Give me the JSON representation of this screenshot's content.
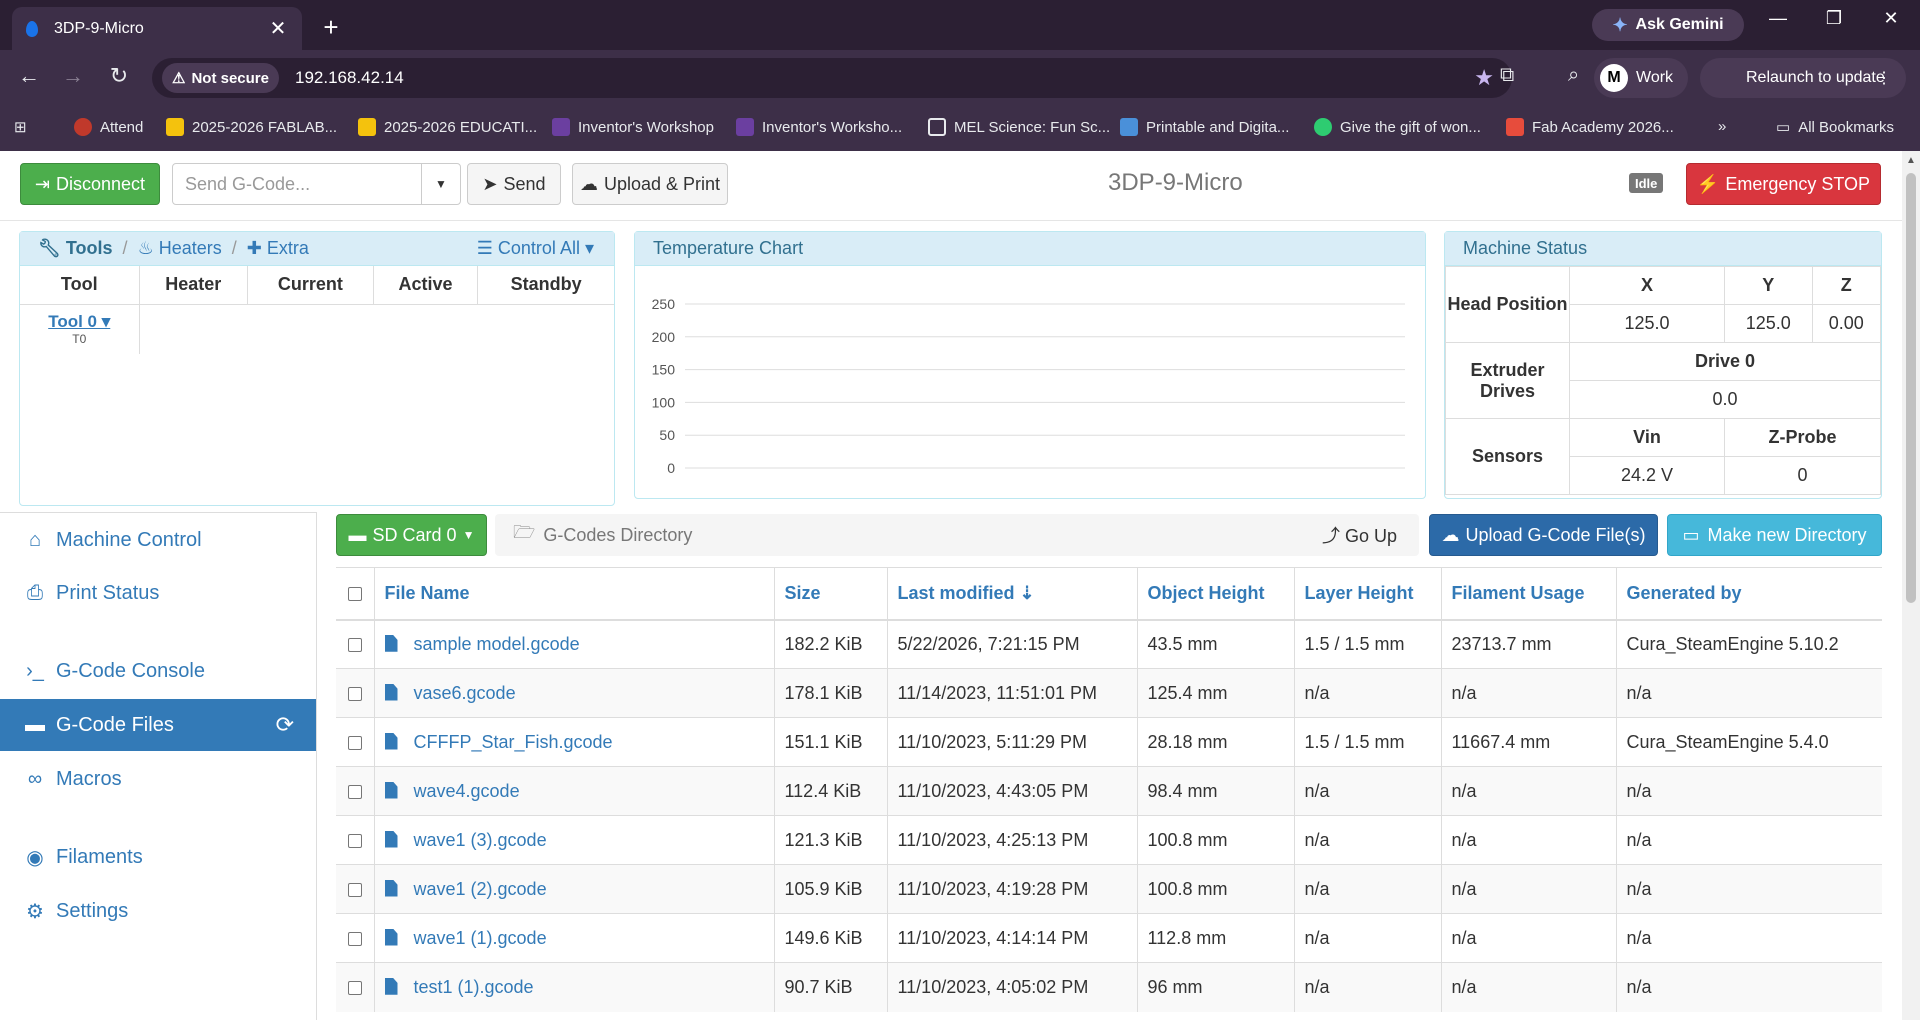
{
  "browser": {
    "tab_title": "3DP-9-Micro",
    "ask_gemini": "Ask Gemini",
    "not_secure": "Not secure",
    "url": "192.168.42.14",
    "profile": "Work",
    "relaunch": "Relaunch to update",
    "bookmarks": [
      "Attend",
      "2025-2026 FABLAB...",
      "2025-2026 EDUCATI...",
      "Inventor's Workshop",
      "Inventor's Worksho...",
      "MEL Science: Fun Sc...",
      "Printable and Digita...",
      "Give the gift of won...",
      "Fab Academy 2026..."
    ],
    "all_bookmarks": "All Bookmarks"
  },
  "topbar": {
    "disconnect": "Disconnect",
    "gcode_placeholder": "Send G-Code...",
    "send": "Send",
    "upload_print": "Upload & Print",
    "machine_name": "3DP-9-Micro",
    "status": "Idle",
    "emergency": "Emergency STOP"
  },
  "tools_panel": {
    "tools": "Tools",
    "heaters": "Heaters",
    "extra": "Extra",
    "control_all": "Control All",
    "columns": [
      "Tool",
      "Heater",
      "Current",
      "Active",
      "Standby"
    ],
    "tool_name": "Tool 0",
    "tool_code": "T0"
  },
  "temperature_chart": {
    "title": "Temperature Chart"
  },
  "chart_data": {
    "type": "line",
    "title": "Temperature Chart",
    "yticks": [
      250,
      200,
      150,
      100,
      50,
      0
    ],
    "ylim": [
      0,
      250
    ],
    "series": []
  },
  "machine_status": {
    "title": "Machine Status",
    "head_position": "Head Position",
    "axes": [
      "X",
      "Y",
      "Z"
    ],
    "positions": [
      "125.0",
      "125.0",
      "0.00"
    ],
    "extruder_drives": "Extruder Drives",
    "drive_label": "Drive 0",
    "drive_value": "0.0",
    "sensors": "Sensors",
    "vin_label": "Vin",
    "vin_value": "24.2 V",
    "zprobe_label": "Z-Probe",
    "zprobe_value": "0"
  },
  "sidebar": {
    "items": [
      "Machine Control",
      "Print Status",
      "G-Code Console",
      "G-Code Files",
      "Macros",
      "Filaments",
      "Settings"
    ]
  },
  "files": {
    "sd_card": "SD Card 0",
    "directory": "G-Codes Directory",
    "go_up": "Go Up",
    "upload": "Upload G-Code File(s)",
    "make_dir": "Make new Directory",
    "columns": [
      "File Name",
      "Size",
      "Last modified",
      "Object Height",
      "Layer Height",
      "Filament Usage",
      "Generated by"
    ],
    "rows": [
      [
        "sample model.gcode",
        "182.2 KiB",
        "5/22/2026, 7:21:15 PM",
        "43.5 mm",
        "1.5 / 1.5 mm",
        "23713.7 mm",
        "Cura_SteamEngine 5.10.2"
      ],
      [
        "vase6.gcode",
        "178.1 KiB",
        "11/14/2023, 11:51:01 PM",
        "125.4 mm",
        "n/a",
        "n/a",
        "n/a"
      ],
      [
        "CFFFP_Star_Fish.gcode",
        "151.1 KiB",
        "11/10/2023, 5:11:29 PM",
        "28.18 mm",
        "1.5 / 1.5 mm",
        "11667.4 mm",
        "Cura_SteamEngine 5.4.0"
      ],
      [
        "wave4.gcode",
        "112.4 KiB",
        "11/10/2023, 4:43:05 PM",
        "98.4 mm",
        "n/a",
        "n/a",
        "n/a"
      ],
      [
        "wave1 (3).gcode",
        "121.3 KiB",
        "11/10/2023, 4:25:13 PM",
        "100.8 mm",
        "n/a",
        "n/a",
        "n/a"
      ],
      [
        "wave1 (2).gcode",
        "105.9 KiB",
        "11/10/2023, 4:19:28 PM",
        "100.8 mm",
        "n/a",
        "n/a",
        "n/a"
      ],
      [
        "wave1 (1).gcode",
        "149.6 KiB",
        "11/10/2023, 4:14:14 PM",
        "112.8 mm",
        "n/a",
        "n/a",
        "n/a"
      ],
      [
        "test1 (1).gcode",
        "90.7 KiB",
        "11/10/2023, 4:05:02 PM",
        "96 mm",
        "n/a",
        "n/a",
        "n/a"
      ]
    ]
  }
}
